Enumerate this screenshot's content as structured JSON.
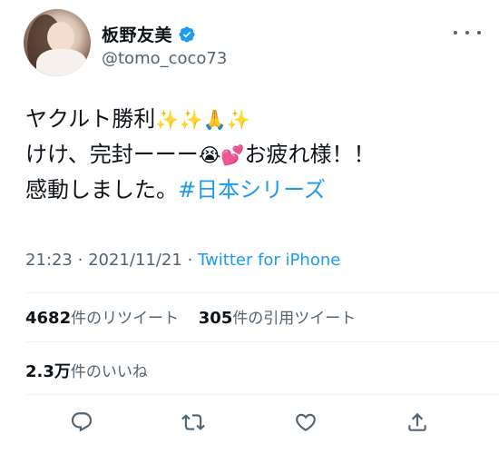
{
  "tweet": {
    "author": {
      "display_name": "板野友美",
      "handle": "@tomo_coco73",
      "verified": true
    },
    "text_lines": [
      [
        "ヤクルト勝利",
        "✨",
        "✨",
        "🙏",
        "✨"
      ],
      [
        "けけ、完封ーーー",
        "😭",
        "💕",
        "お疲れ様！！"
      ],
      [
        "感動しました。",
        "#日本シリーズ"
      ]
    ],
    "time": "21:23",
    "separator": "·",
    "date": "2021/11/21",
    "source": "Twitter for iPhone",
    "stats": {
      "retweets_count": "4682",
      "retweets_label": "件のリツイート",
      "quotes_count": "305",
      "quotes_label": "件の引用ツイート",
      "likes_count": "2.3万",
      "likes_label": "件のいいね"
    },
    "actions": [
      "reply-icon",
      "retweet-icon",
      "like-icon",
      "share-icon"
    ],
    "colors": {
      "accent": "#1d9bf0",
      "text": "#0f1419",
      "muted": "#536471",
      "divider": "#eff3f4"
    }
  }
}
